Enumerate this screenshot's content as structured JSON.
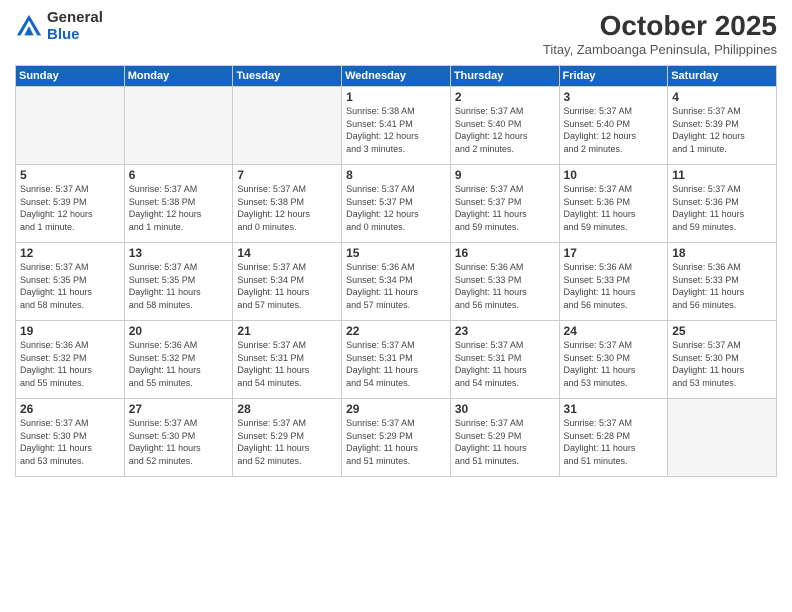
{
  "logo": {
    "general": "General",
    "blue": "Blue"
  },
  "header": {
    "month": "October 2025",
    "location": "Titay, Zamboanga Peninsula, Philippines"
  },
  "weekdays": [
    "Sunday",
    "Monday",
    "Tuesday",
    "Wednesday",
    "Thursday",
    "Friday",
    "Saturday"
  ],
  "weeks": [
    [
      {
        "day": "",
        "info": ""
      },
      {
        "day": "",
        "info": ""
      },
      {
        "day": "",
        "info": ""
      },
      {
        "day": "1",
        "info": "Sunrise: 5:38 AM\nSunset: 5:41 PM\nDaylight: 12 hours\nand 3 minutes."
      },
      {
        "day": "2",
        "info": "Sunrise: 5:37 AM\nSunset: 5:40 PM\nDaylight: 12 hours\nand 2 minutes."
      },
      {
        "day": "3",
        "info": "Sunrise: 5:37 AM\nSunset: 5:40 PM\nDaylight: 12 hours\nand 2 minutes."
      },
      {
        "day": "4",
        "info": "Sunrise: 5:37 AM\nSunset: 5:39 PM\nDaylight: 12 hours\nand 1 minute."
      }
    ],
    [
      {
        "day": "5",
        "info": "Sunrise: 5:37 AM\nSunset: 5:39 PM\nDaylight: 12 hours\nand 1 minute."
      },
      {
        "day": "6",
        "info": "Sunrise: 5:37 AM\nSunset: 5:38 PM\nDaylight: 12 hours\nand 1 minute."
      },
      {
        "day": "7",
        "info": "Sunrise: 5:37 AM\nSunset: 5:38 PM\nDaylight: 12 hours\nand 0 minutes."
      },
      {
        "day": "8",
        "info": "Sunrise: 5:37 AM\nSunset: 5:37 PM\nDaylight: 12 hours\nand 0 minutes."
      },
      {
        "day": "9",
        "info": "Sunrise: 5:37 AM\nSunset: 5:37 PM\nDaylight: 11 hours\nand 59 minutes."
      },
      {
        "day": "10",
        "info": "Sunrise: 5:37 AM\nSunset: 5:36 PM\nDaylight: 11 hours\nand 59 minutes."
      },
      {
        "day": "11",
        "info": "Sunrise: 5:37 AM\nSunset: 5:36 PM\nDaylight: 11 hours\nand 59 minutes."
      }
    ],
    [
      {
        "day": "12",
        "info": "Sunrise: 5:37 AM\nSunset: 5:35 PM\nDaylight: 11 hours\nand 58 minutes."
      },
      {
        "day": "13",
        "info": "Sunrise: 5:37 AM\nSunset: 5:35 PM\nDaylight: 11 hours\nand 58 minutes."
      },
      {
        "day": "14",
        "info": "Sunrise: 5:37 AM\nSunset: 5:34 PM\nDaylight: 11 hours\nand 57 minutes."
      },
      {
        "day": "15",
        "info": "Sunrise: 5:36 AM\nSunset: 5:34 PM\nDaylight: 11 hours\nand 57 minutes."
      },
      {
        "day": "16",
        "info": "Sunrise: 5:36 AM\nSunset: 5:33 PM\nDaylight: 11 hours\nand 56 minutes."
      },
      {
        "day": "17",
        "info": "Sunrise: 5:36 AM\nSunset: 5:33 PM\nDaylight: 11 hours\nand 56 minutes."
      },
      {
        "day": "18",
        "info": "Sunrise: 5:36 AM\nSunset: 5:33 PM\nDaylight: 11 hours\nand 56 minutes."
      }
    ],
    [
      {
        "day": "19",
        "info": "Sunrise: 5:36 AM\nSunset: 5:32 PM\nDaylight: 11 hours\nand 55 minutes."
      },
      {
        "day": "20",
        "info": "Sunrise: 5:36 AM\nSunset: 5:32 PM\nDaylight: 11 hours\nand 55 minutes."
      },
      {
        "day": "21",
        "info": "Sunrise: 5:37 AM\nSunset: 5:31 PM\nDaylight: 11 hours\nand 54 minutes."
      },
      {
        "day": "22",
        "info": "Sunrise: 5:37 AM\nSunset: 5:31 PM\nDaylight: 11 hours\nand 54 minutes."
      },
      {
        "day": "23",
        "info": "Sunrise: 5:37 AM\nSunset: 5:31 PM\nDaylight: 11 hours\nand 54 minutes."
      },
      {
        "day": "24",
        "info": "Sunrise: 5:37 AM\nSunset: 5:30 PM\nDaylight: 11 hours\nand 53 minutes."
      },
      {
        "day": "25",
        "info": "Sunrise: 5:37 AM\nSunset: 5:30 PM\nDaylight: 11 hours\nand 53 minutes."
      }
    ],
    [
      {
        "day": "26",
        "info": "Sunrise: 5:37 AM\nSunset: 5:30 PM\nDaylight: 11 hours\nand 53 minutes."
      },
      {
        "day": "27",
        "info": "Sunrise: 5:37 AM\nSunset: 5:30 PM\nDaylight: 11 hours\nand 52 minutes."
      },
      {
        "day": "28",
        "info": "Sunrise: 5:37 AM\nSunset: 5:29 PM\nDaylight: 11 hours\nand 52 minutes."
      },
      {
        "day": "29",
        "info": "Sunrise: 5:37 AM\nSunset: 5:29 PM\nDaylight: 11 hours\nand 51 minutes."
      },
      {
        "day": "30",
        "info": "Sunrise: 5:37 AM\nSunset: 5:29 PM\nDaylight: 11 hours\nand 51 minutes."
      },
      {
        "day": "31",
        "info": "Sunrise: 5:37 AM\nSunset: 5:28 PM\nDaylight: 11 hours\nand 51 minutes."
      },
      {
        "day": "",
        "info": ""
      }
    ]
  ]
}
